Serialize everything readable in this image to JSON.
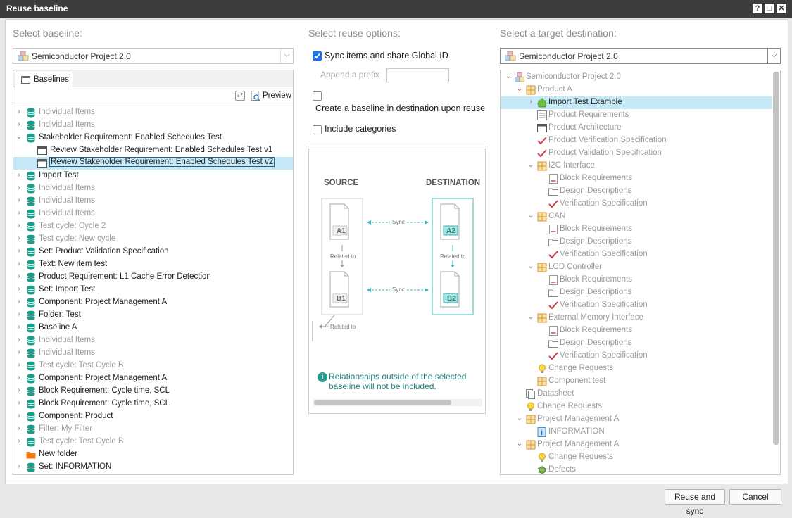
{
  "window": {
    "title": "Reuse baseline"
  },
  "titlebar_buttons": {
    "help": "?",
    "maximize": "□",
    "close": "✕"
  },
  "left": {
    "section_title": "Select baseline:",
    "project_combo": "Semiconductor Project 2.0",
    "tab_label": "Baselines",
    "preview_label": "Preview",
    "rows": [
      {
        "label": "Individual Items",
        "dim": true,
        "expandable": true,
        "icon": "database"
      },
      {
        "label": "Individual Items",
        "dim": true,
        "expandable": true,
        "icon": "database"
      },
      {
        "label": "Stakeholder Requirement: Enabled Schedules Test",
        "dim": false,
        "expandable": true,
        "expanded": true,
        "icon": "database"
      },
      {
        "label": "Review Stakeholder Requirement: Enabled Schedules Test v1",
        "dim": false,
        "child": true,
        "icon": "window"
      },
      {
        "label": "Review Stakeholder Requirement: Enabled Schedules Test v2",
        "dim": false,
        "child": true,
        "icon": "window",
        "selected": true
      },
      {
        "label": "Import Test",
        "dim": false,
        "expandable": true,
        "icon": "database"
      },
      {
        "label": "Individual Items",
        "dim": true,
        "expandable": true,
        "icon": "database"
      },
      {
        "label": "Individual Items",
        "dim": true,
        "expandable": true,
        "icon": "database"
      },
      {
        "label": "Individual Items",
        "dim": true,
        "expandable": true,
        "icon": "database"
      },
      {
        "label": "Test cycle: Cycle 2",
        "dim": true,
        "expandable": true,
        "icon": "database"
      },
      {
        "label": "Test cycle: New cycle",
        "dim": true,
        "expandable": true,
        "icon": "database"
      },
      {
        "label": "Set: Product Validation Specification",
        "dim": false,
        "expandable": true,
        "icon": "database"
      },
      {
        "label": "Text: New item test",
        "dim": false,
        "expandable": true,
        "icon": "database"
      },
      {
        "label": "Product Requirement: L1 Cache Error Detection",
        "dim": false,
        "expandable": true,
        "icon": "database"
      },
      {
        "label": "Set: Import Test",
        "dim": false,
        "expandable": true,
        "icon": "database"
      },
      {
        "label": "Component: Project Management A",
        "dim": false,
        "expandable": true,
        "icon": "database"
      },
      {
        "label": "Folder: Test",
        "dim": false,
        "expandable": true,
        "icon": "database"
      },
      {
        "label": "Baseline A",
        "dim": false,
        "expandable": true,
        "icon": "database"
      },
      {
        "label": "Individual Items",
        "dim": true,
        "expandable": true,
        "icon": "database"
      },
      {
        "label": "Individual Items",
        "dim": true,
        "expandable": true,
        "icon": "database"
      },
      {
        "label": "Test cycle: Test Cycle B",
        "dim": true,
        "expandable": true,
        "icon": "database"
      },
      {
        "label": "Component: Project Management A",
        "dim": false,
        "expandable": true,
        "icon": "database"
      },
      {
        "label": "Block Requirement: Cycle time, SCL",
        "dim": false,
        "expandable": true,
        "icon": "database"
      },
      {
        "label": "Block Requirement: Cycle time, SCL",
        "dim": false,
        "expandable": true,
        "icon": "database"
      },
      {
        "label": "Component: Product",
        "dim": false,
        "expandable": true,
        "icon": "database"
      },
      {
        "label": "Filter: My Filter",
        "dim": true,
        "expandable": true,
        "icon": "database"
      },
      {
        "label": "Test cycle: Test Cycle B",
        "dim": true,
        "expandable": true,
        "icon": "database"
      },
      {
        "label": "New folder",
        "dim": false,
        "expandable": false,
        "icon": "folder"
      },
      {
        "label": "Set: INFORMATION",
        "dim": false,
        "expandable": true,
        "icon": "database"
      }
    ]
  },
  "middle": {
    "section_title": "Select reuse options:",
    "sync_label": "Sync items and share Global ID",
    "sync_checked": true,
    "prefix_label": "Append a prefix",
    "prefix_value": "",
    "create_baseline_label": "Create a baseline in destination upon reuse",
    "create_baseline_checked": false,
    "include_categories_label": "Include categories",
    "include_categories_checked": false,
    "diagram": {
      "source_label": "SOURCE",
      "destination_label": "DESTINATION",
      "a1": "A1",
      "b1": "B1",
      "a2": "A2",
      "b2": "B2",
      "sync": "Sync",
      "related_to": "Related to"
    },
    "info_text_line1": "Relationships outside of the selected",
    "info_text_line2": "baseline will not be included."
  },
  "right": {
    "section_title": "Select a target destination:",
    "project_combo": "Semiconductor Project 2.0",
    "rows": [
      {
        "label": "Semiconductor Project 2.0",
        "level": 0,
        "expander": "down",
        "icon": "project"
      },
      {
        "label": "Product A",
        "level": 1,
        "expander": "down",
        "icon": "component"
      },
      {
        "label": "Import Test Example",
        "level": 2,
        "expander": "right",
        "icon": "puzzle",
        "selected": true,
        "bright": true
      },
      {
        "label": "Product Requirements",
        "level": 2,
        "icon": "list"
      },
      {
        "label": "Product Architecture",
        "level": 2,
        "icon": "window"
      },
      {
        "label": "Product Verification Specification",
        "level": 2,
        "icon": "check"
      },
      {
        "label": "Product Validation Specification",
        "level": 2,
        "icon": "check"
      },
      {
        "label": "I2C Interface",
        "level": 2,
        "expander": "down",
        "icon": "component"
      },
      {
        "label": "Block Requirements",
        "level": 3,
        "icon": "req"
      },
      {
        "label": "Design Descriptions",
        "level": 3,
        "icon": "folder-outline"
      },
      {
        "label": "Verification Specification",
        "level": 3,
        "icon": "check"
      },
      {
        "label": "CAN",
        "level": 2,
        "expander": "down",
        "icon": "component"
      },
      {
        "label": "Block Requirements",
        "level": 3,
        "icon": "req"
      },
      {
        "label": "Design Descriptions",
        "level": 3,
        "icon": "folder-outline"
      },
      {
        "label": "Verification Specification",
        "level": 3,
        "icon": "check"
      },
      {
        "label": "LCD Controller",
        "level": 2,
        "expander": "down",
        "icon": "component"
      },
      {
        "label": "Block Requirements",
        "level": 3,
        "icon": "req"
      },
      {
        "label": "Design Descriptions",
        "level": 3,
        "icon": "folder-outline"
      },
      {
        "label": "Verification Specification",
        "level": 3,
        "icon": "check"
      },
      {
        "label": "External Memory Interface",
        "level": 2,
        "expander": "down",
        "icon": "component"
      },
      {
        "label": "Block Requirements",
        "level": 3,
        "icon": "req"
      },
      {
        "label": "Design Descriptions",
        "level": 3,
        "icon": "folder-outline"
      },
      {
        "label": "Verification Specification",
        "level": 3,
        "icon": "check"
      },
      {
        "label": "Change Requests",
        "level": 2,
        "icon": "bulb"
      },
      {
        "label": "Component test",
        "level": 2,
        "icon": "component"
      },
      {
        "label": "Datasheet",
        "level": 1,
        "icon": "docs"
      },
      {
        "label": "Change Requests",
        "level": 1,
        "icon": "bulb"
      },
      {
        "label": "Project Management A",
        "level": 1,
        "expander": "down",
        "icon": "component"
      },
      {
        "label": "INFORMATION",
        "level": 2,
        "icon": "info"
      },
      {
        "label": "Project Management A",
        "level": 1,
        "expander": "down",
        "icon": "component"
      },
      {
        "label": "Change Requests",
        "level": 2,
        "icon": "bulb"
      },
      {
        "label": "Defects",
        "level": 2,
        "icon": "bug"
      }
    ]
  },
  "footer": {
    "reuse_button": "Reuse and sync",
    "cancel_button": "Cancel"
  },
  "colors": {
    "accent": "#1a73e8",
    "selection": "#c6e9f8",
    "teal": "#3bb6b1",
    "db_icon": "#1a9c8c"
  }
}
